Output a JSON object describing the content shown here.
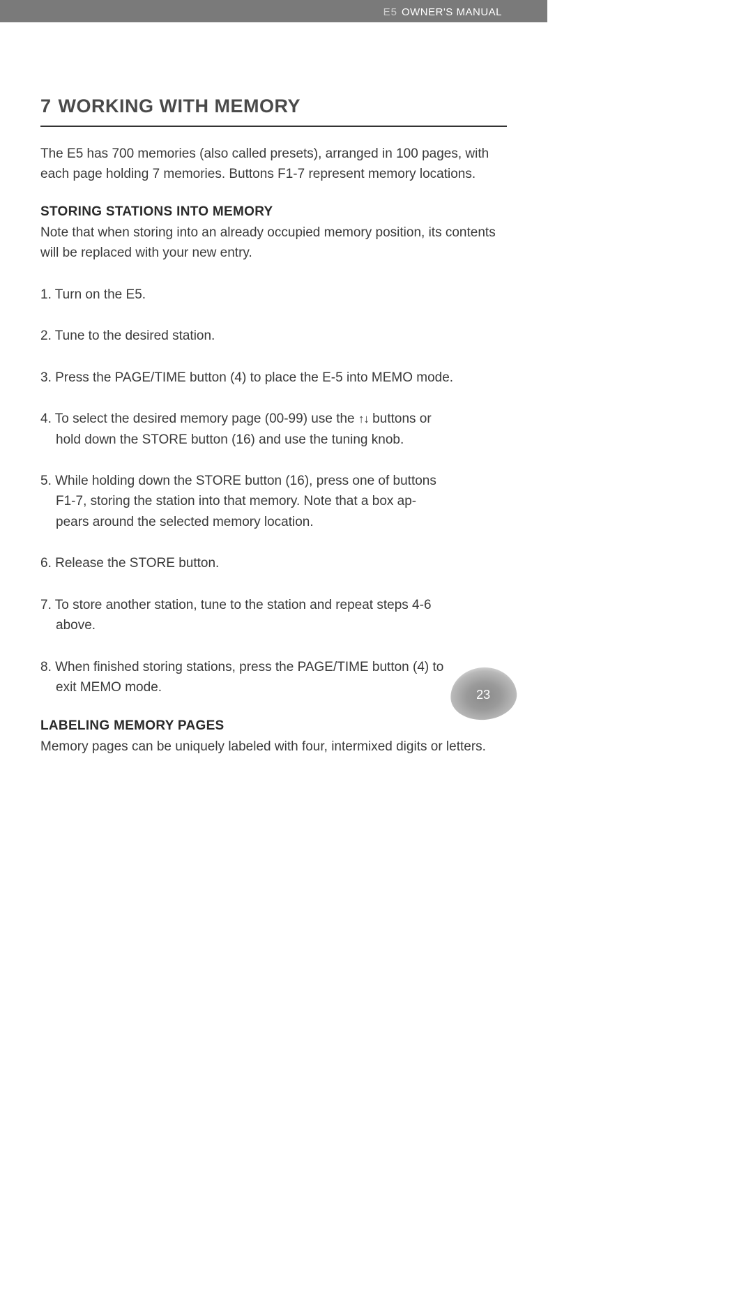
{
  "header": {
    "product": "E5",
    "title": "OWNER'S MANUAL"
  },
  "chapter": {
    "number": "7",
    "title": "WORKING WITH MEMORY"
  },
  "intro": "The E5 has 700 memories (also called presets), arranged in 100 pages, with each page holding 7 memories. Buttons F1-7 represent memory locations.",
  "section1": {
    "heading": "STORING STATIONS INTO MEMORY",
    "note": "Note that when storing into an already occupied memory position, its contents will be replaced with your new entry.",
    "steps": {
      "s1": "1. Turn on the E5.",
      "s2": "2. Tune to the desired station.",
      "s3": "3. Press the PAGE/TIME button (4) to place the E-5 into MEMO mode.",
      "s4_a": "4. To select the desired memory page (00-99) use the ",
      "s4_b": " buttons or",
      "s4_c": "hold down the STORE button (16) and use the tuning knob.",
      "s5_a": "5. While holding down the STORE button (16), press one of buttons",
      "s5_b": "F1-7, storing the station into that memory. Note that a box ap-",
      "s5_c": "pears around the selected memory location.",
      "s6": "6. Release the STORE button.",
      "s7_a": "7. To store another station, tune to the station and repeat steps 4-6",
      "s7_b": "above.",
      "s8_a": "8. When finished storing stations, press the PAGE/TIME button (4) to",
      "s8_b": "exit MEMO mode."
    }
  },
  "section2": {
    "heading": "LABELING MEMORY PAGES",
    "text": "Memory pages can be uniquely labeled with four, intermixed digits or letters."
  },
  "page_number": "23"
}
